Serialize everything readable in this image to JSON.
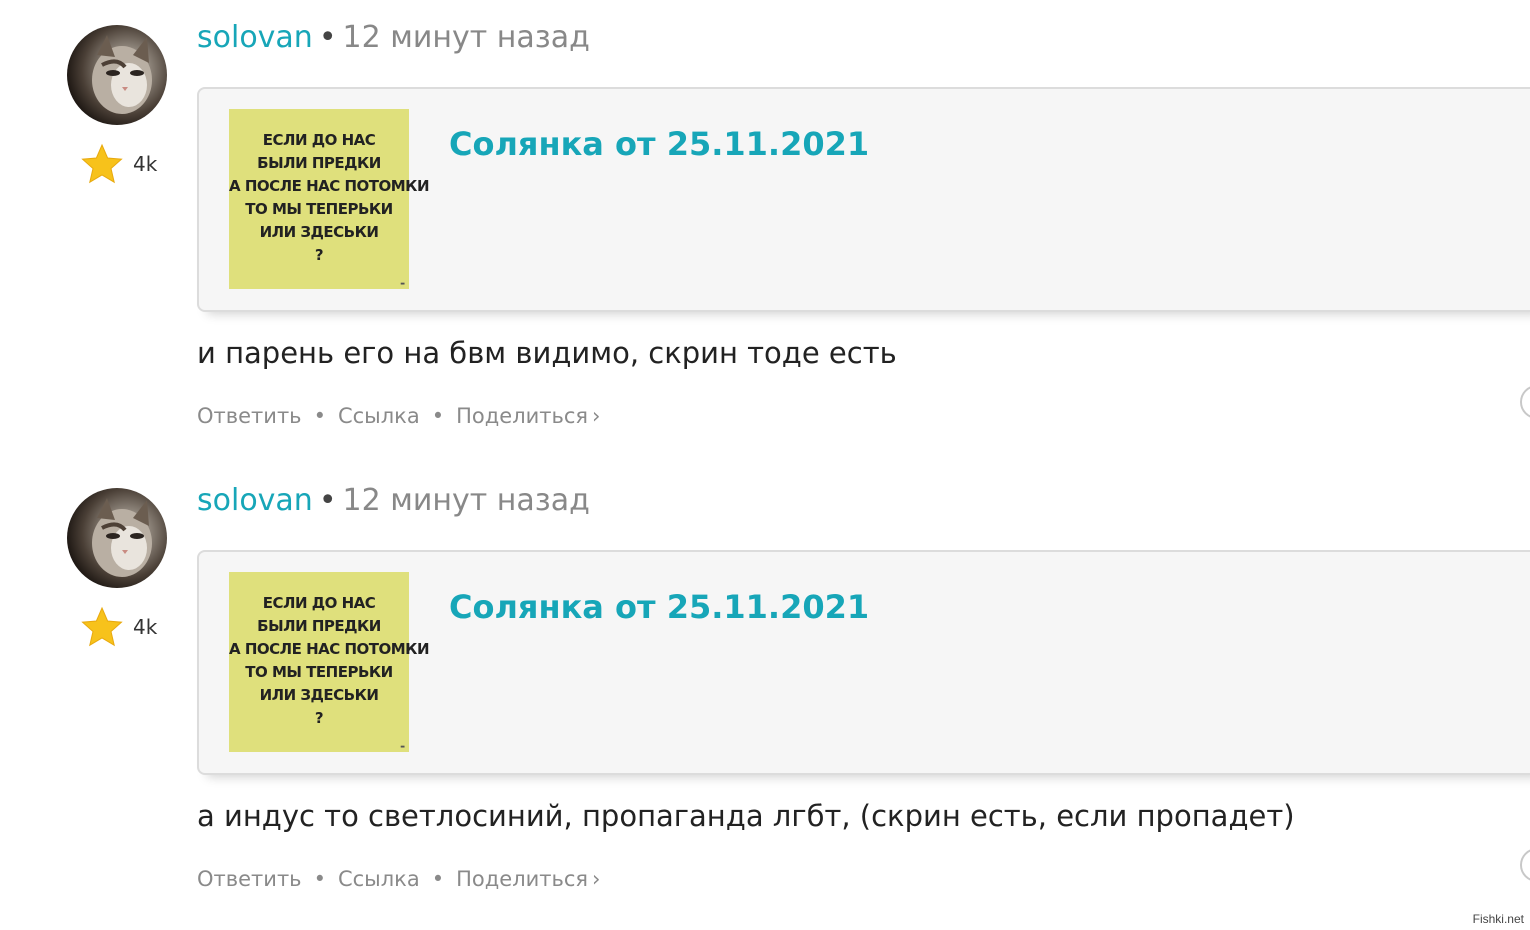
{
  "comments": [
    {
      "author": "solovan",
      "separator": "•",
      "time": "12 минут назад",
      "rating": "4k",
      "embed": {
        "title": "Солянка от 25.11.2021",
        "image_text": "ЕСЛИ ДО НАС\nБЫЛИ ПРЕДКИ\nА ПОСЛЕ НАС ПОТОМКИ\nТО МЫ ТЕПЕРЬКИ\nИЛИ ЗДЕСЬКИ\n?"
      },
      "text": "и парень его на бвм видимо, скрин тоде есть",
      "actions": {
        "reply": "Ответить",
        "link": "Ссылка",
        "share": "Поделиться",
        "share_chevron": "›",
        "sep": "•"
      }
    },
    {
      "author": "solovan",
      "separator": "•",
      "time": "12 минут назад",
      "rating": "4k",
      "embed": {
        "title": "Солянка от 25.11.2021",
        "image_text": "ЕСЛИ ДО НАС\nБЫЛИ ПРЕДКИ\nА ПОСЛЕ НАС ПОТОМКИ\nТО МЫ ТЕПЕРЬКИ\nИЛИ ЗДЕСЬКИ\n?"
      },
      "text": "а индус то светлосиний, пропаганда лгбт, (скрин есть, если пропадет)",
      "actions": {
        "reply": "Ответить",
        "link": "Ссылка",
        "share": "Поделиться",
        "share_chevron": "›",
        "sep": "•"
      }
    }
  ],
  "watermark": "Fishki.net",
  "colors": {
    "accent": "#17a6b8",
    "thumb_bg": "#dfe07c",
    "star": "#f7c21b"
  }
}
